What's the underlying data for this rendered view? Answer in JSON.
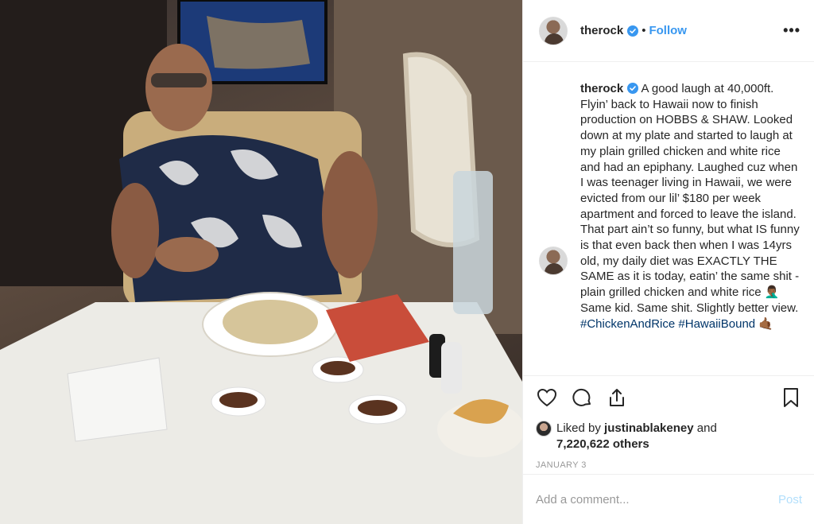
{
  "post": {
    "username": "therock",
    "follow_label": "Follow",
    "separator": "•",
    "more_label": "•••",
    "caption_text": " A good laugh at 40,000ft. Flyin’ back to Hawaii now to finish production on HOBBS & SHAW. Looked down at my plate and started to laugh at my plain grilled chicken and white rice and had an epiphany. Laughed cuz when I was teenager living in Hawaii, we were evicted from our lil’ $180 per week apartment and forced to leave the island. That part ain’t so funny, but what IS funny is that even back then when I was 14yrs old, my daily diet was EXACTLY THE SAME as it is today, eatin’ the same shit - plain grilled chicken and white rice 🤦🏾‍♂️ Same kid. Same shit. Slightly better view.\n",
    "hashtags": [
      "#ChickenAndRice",
      "#HawaiiBound"
    ],
    "hashtag_emoji": "🤙🏾",
    "liked_by_prefix": "Liked by ",
    "liked_by_user": "justinablakeney",
    "liked_by_and": " and",
    "likes_count": "7,220,622 others",
    "date": "JANUARY 3",
    "comment_placeholder": "Add a comment...",
    "post_button": "Post"
  },
  "icons": {
    "verified": "verified-badge-icon",
    "like": "heart-icon",
    "comment": "comment-icon",
    "share": "share-icon",
    "save": "bookmark-icon"
  },
  "colors": {
    "link_blue": "#3897f0",
    "hashtag": "#003569",
    "muted": "#999999",
    "border": "#efefef"
  }
}
